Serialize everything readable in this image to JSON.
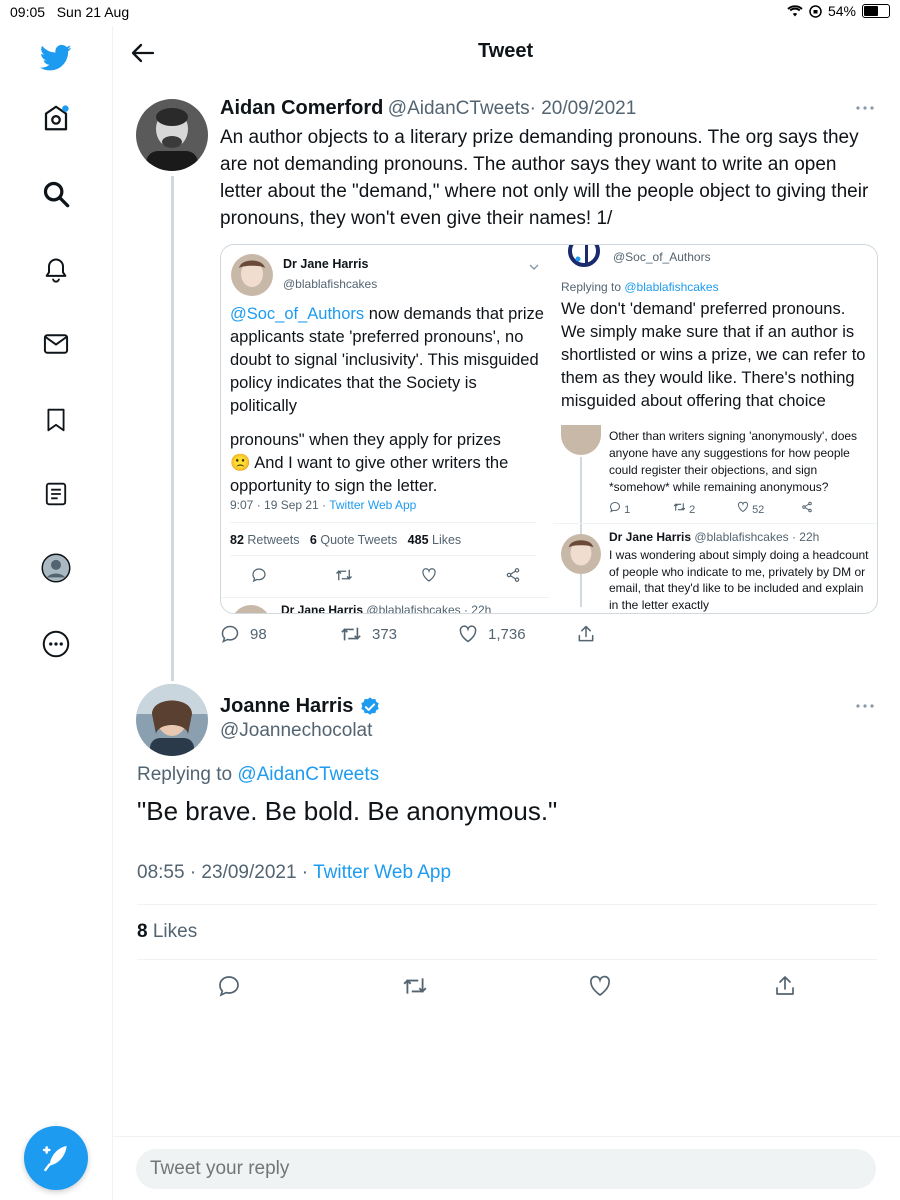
{
  "status": {
    "time": "09:05",
    "date": "Sun 21 Aug",
    "battery": "54%",
    "battery_level": 0.54
  },
  "header": {
    "title": "Tweet"
  },
  "sidebar": {
    "items": [
      {
        "icon": "twitter-logo-icon"
      },
      {
        "icon": "home-icon"
      },
      {
        "icon": "search-icon"
      },
      {
        "icon": "bell-icon"
      },
      {
        "icon": "mail-icon"
      },
      {
        "icon": "bookmark-icon"
      },
      {
        "icon": "lists-icon"
      },
      {
        "icon": "profile-icon"
      },
      {
        "icon": "more-icon"
      }
    ],
    "compose_icon": "compose-tweet-icon"
  },
  "tweet1": {
    "name": "Aidan Comerford",
    "handle": "@AidanCTweets",
    "date": "· 20/09/2021",
    "text": "An author objects to a literary prize demanding pronouns. The org says they are not demanding pronouns. The author says they want to write an open letter about the \"demand,\" where not only will the people object to giving their pronouns, they won't even give their names! 1/",
    "replies": "98",
    "retweets": "373",
    "likes": "1,736"
  },
  "embed": {
    "left": {
      "name": "Dr Jane Harris",
      "handle": "@blablafishcakes",
      "mention": "@Soc_of_Authors",
      "text": " now demands that prize applicants state 'preferred pronouns', no doubt to signal 'inclusivity'. This misguided policy indicates that the Society is politically",
      "text2": "pronouns\" when they apply for prizes",
      "text3": "🙁 And I want to give other writers the opportunity to sign the letter.",
      "meta_time": "9:07 · 19 Sep 21 · ",
      "meta_app": "Twitter Web App",
      "retweets": "82",
      "retweets_label": " Retweets",
      "quotes": "6",
      "quotes_label": " Quote Tweets",
      "likes": "485",
      "likes_label": " Likes",
      "next_name": "Dr Jane Harris",
      "next_handle": "@blablafishcakes · 22h"
    },
    "right": {
      "handle": "@Soc_of_Authors",
      "replying": "Replying to ",
      "replying_to": "@blablafishcakes",
      "text": "We don't 'demand' preferred pronouns. We simply make sure that if an author is shortlisted or wins a prize, we can refer to them as they would like. There's nothing misguided about offering that choice",
      "reply_text": "Other than writers signing 'anonymously', does anyone have any suggestions for how people could register their objections, and sign *somehow* while remaining anonymous?",
      "reply_replies": "1",
      "reply_retweets": "2",
      "reply_likes": "52",
      "reply2_name": "Dr Jane Harris",
      "reply2_handle": "@blablafishcakes · 22h",
      "reply2_text": "I was wondering about simply doing a headcount of people who indicate to me, privately by DM or email, that they'd like to be included and explain in the letter exactly"
    }
  },
  "tweet2": {
    "name": "Joanne Harris",
    "handle": "@Joannechocolat",
    "replying_label": "Replying to ",
    "replying_to": "@AidanCTweets",
    "text": "\"Be brave. Be bold. Be anonymous.\"",
    "time": "08:55 · 23/09/2021 · ",
    "app": "Twitter Web App",
    "likes_count": "8",
    "likes_label": " Likes"
  },
  "reply": {
    "placeholder": "Tweet your reply"
  }
}
